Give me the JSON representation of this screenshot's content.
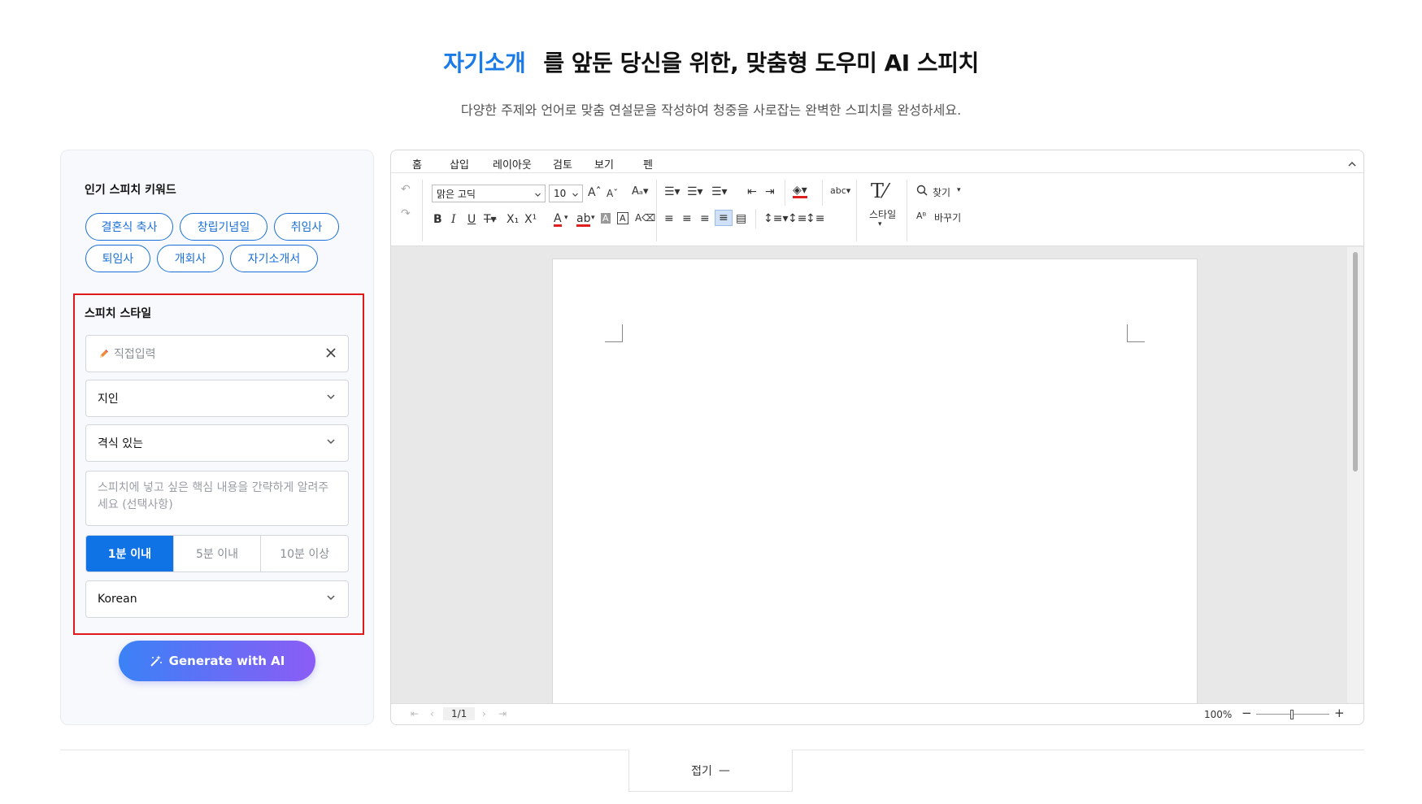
{
  "hero": {
    "keyword": "자기소개",
    "title_rest": "를 앞둔 당신을 위한, 맞춤형 도우미 AI 스피치",
    "subtitle": "다양한 주제와 언어로 맞춤 연설문을 작성하여 청중을 사로잡는 완벽한 스피치를 완성하세요."
  },
  "keywords": {
    "label": "인기 스피치 키워드",
    "chips": [
      "결혼식 축사",
      "창립기념일",
      "취임사",
      "퇴임사",
      "개회사",
      "자기소개서"
    ]
  },
  "style": {
    "label": "스피치 스타일",
    "direct_input_placeholder": "직접입력",
    "audience": "지인",
    "tone": "격식 있는",
    "content_placeholder": "스피치에 넣고 싶은 핵심 내용을 간략하게 알려주세요 (선택사항)",
    "durations": [
      "1분 이내",
      "5분 이내",
      "10분 이상"
    ],
    "selected_duration": "1분 이내",
    "language": "Korean"
  },
  "generate_label": "Generate with AI",
  "editor": {
    "tabs": [
      "홈",
      "삽입",
      "레이아웃",
      "검토",
      "보기",
      "펜"
    ],
    "active_tab": "홈",
    "font_name": "맑은 고딕",
    "font_size": "10",
    "style_label": "스타일",
    "find_label": "찾기",
    "replace_label": "바꾸기",
    "page_indicator": "1/1",
    "zoom": "100%"
  },
  "fold_label": "접기",
  "colors": {
    "accent": "#1a7ae8",
    "highlight_box": "#e01a1a",
    "gradient_start": "#3b82f6",
    "gradient_end": "#8b5cf6"
  }
}
